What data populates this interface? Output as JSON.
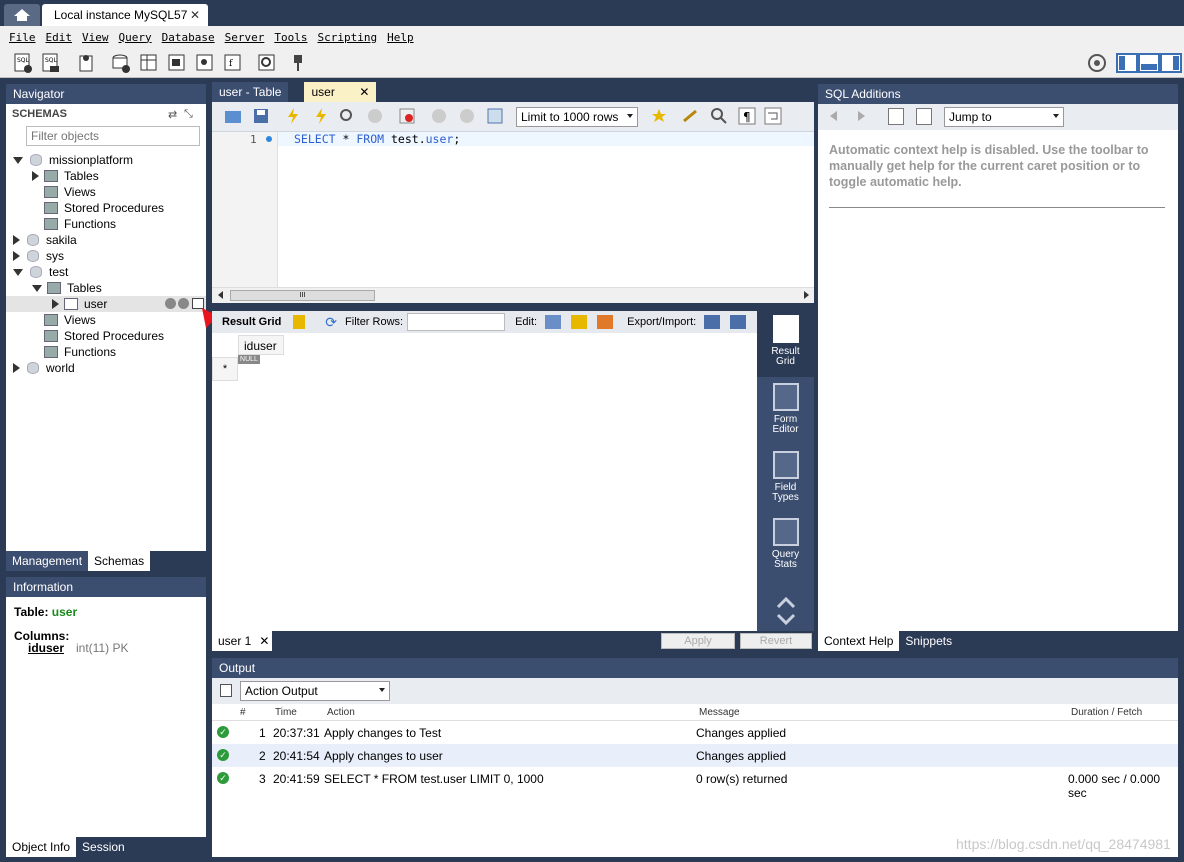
{
  "window": {
    "instance_tab": "Local instance MySQL57"
  },
  "menu": [
    "File",
    "Edit",
    "View",
    "Query",
    "Database",
    "Server",
    "Tools",
    "Scripting",
    "Help"
  ],
  "navigator": {
    "title": "Navigator",
    "schemas_label": "SCHEMAS",
    "filter_placeholder": "Filter objects",
    "tree": {
      "missionplatform": "missionplatform",
      "mp_tables": "Tables",
      "mp_views": "Views",
      "mp_procs": "Stored Procedures",
      "mp_funcs": "Functions",
      "sakila": "sakila",
      "sys": "sys",
      "test": "test",
      "test_tables": "Tables",
      "user": "user",
      "test_views": "Views",
      "test_procs": "Stored Procedures",
      "test_funcs": "Functions",
      "world": "world"
    },
    "tabs": [
      "Management",
      "Schemas"
    ]
  },
  "information": {
    "title": "Information",
    "table_label": "Table:",
    "table_name": "user",
    "columns_label": "Columns:",
    "column_name": "iduser",
    "column_type": "int(11) PK",
    "tabs": [
      "Object Info",
      "Session"
    ]
  },
  "editor": {
    "tabs": [
      "user - Table",
      "user"
    ],
    "limit": "Limit to 1000 rows",
    "line_number": "1",
    "sql_keyword1": "SELECT",
    "sql_star": "*",
    "sql_keyword2": "FROM",
    "sql_table": "test.",
    "sql_table2": "user",
    "sql_end": ";",
    "scroll_grip": "III"
  },
  "result": {
    "result_grid": "Result Grid",
    "filter_rows": "Filter Rows:",
    "edit": "Edit:",
    "export": "Export/Import:",
    "column": "iduser",
    "null": "NULL",
    "row_marker": "*",
    "side": {
      "result_grid_1": "Result",
      "result_grid_2": "Grid",
      "form_editor_1": "Form",
      "form_editor_2": "Editor",
      "field_types_1": "Field",
      "field_types_2": "Types",
      "query_stats_1": "Query",
      "query_stats_2": "Stats"
    },
    "tab": "user 1",
    "apply": "Apply",
    "revert": "Revert"
  },
  "sql_additions": {
    "title": "SQL Additions",
    "jump_to": "Jump to",
    "help_text": "Automatic context help is disabled. Use the toolbar to manually get help for the current caret position or to toggle automatic help.",
    "tabs": [
      "Context Help",
      "Snippets"
    ]
  },
  "output": {
    "title": "Output",
    "mode": "Action Output",
    "headers": {
      "num": "#",
      "time": "Time",
      "action": "Action",
      "message": "Message",
      "duration": "Duration / Fetch"
    },
    "rows": [
      {
        "num": "1",
        "time": "20:37:31",
        "action": "Apply changes to Test",
        "message": "Changes applied",
        "duration": ""
      },
      {
        "num": "2",
        "time": "20:41:54",
        "action": "Apply changes to user",
        "message": "Changes applied",
        "duration": ""
      },
      {
        "num": "3",
        "time": "20:41:59",
        "action": "SELECT * FROM test.user LIMIT 0, 1000",
        "message": "0 row(s) returned",
        "duration": "0.000 sec / 0.000 sec"
      }
    ]
  },
  "watermark": "https://blog.csdn.net/qq_28474981",
  "colors": {
    "accent": "#3c4e70",
    "tab_active": "#fbf1c7",
    "sql_keyword": "#2e5fd0",
    "ok": "#2e9b3a"
  }
}
